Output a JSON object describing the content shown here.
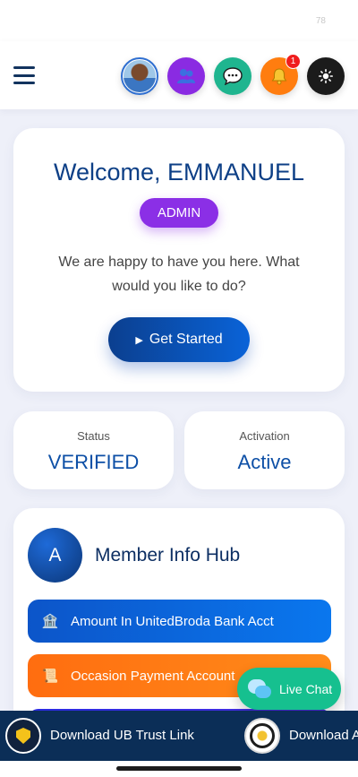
{
  "status_bar": {
    "number": "78"
  },
  "header": {
    "icons": {
      "avatar": "user-avatar-photo",
      "users": "users-icon",
      "chat": "chat-bubble-icon",
      "bell": "bell-icon",
      "theme": "sun-icon"
    },
    "notification_count": "1",
    "colors": {
      "users": "#8a2be2",
      "chat": "#1fb58f",
      "bell": "#ff7d0f",
      "theme": "#1b1b1b",
      "badge": "#f01d1d"
    }
  },
  "welcome": {
    "title": "Welcome, EMMANUEL",
    "role": "ADMIN",
    "message": "We are happy to have you here. What would you like to do?",
    "cta_label": "Get Started"
  },
  "stats": [
    {
      "label": "Status",
      "value": "VERIFIED"
    },
    {
      "label": "Activation",
      "value": "Active"
    }
  ],
  "hub": {
    "avatar_letter": "A",
    "title": "Member Info Hub",
    "items": [
      {
        "label": "Amount In UnitedBroda Bank Acct",
        "icon": "bank-icon",
        "color": "#0a66dd"
      },
      {
        "label": "Occasion Payment Account",
        "icon": "scroll-icon",
        "color": "#ff7a14"
      },
      {
        "label": "",
        "icon": "",
        "color": "#3a2ce0"
      }
    ]
  },
  "live_chat": {
    "label": "Live Chat"
  },
  "bottom_bar": {
    "items": [
      {
        "label": "Download UB Trust Link",
        "logo": "ub-trustlink-logo"
      },
      {
        "label": "Download A",
        "logo": "ubu-logo"
      }
    ]
  },
  "theme_colors": {
    "primary": "#0d3f86",
    "accent_purple": "#8b2fe6",
    "background": "#eef0f9",
    "bottom_bar": "#0b2e57"
  }
}
